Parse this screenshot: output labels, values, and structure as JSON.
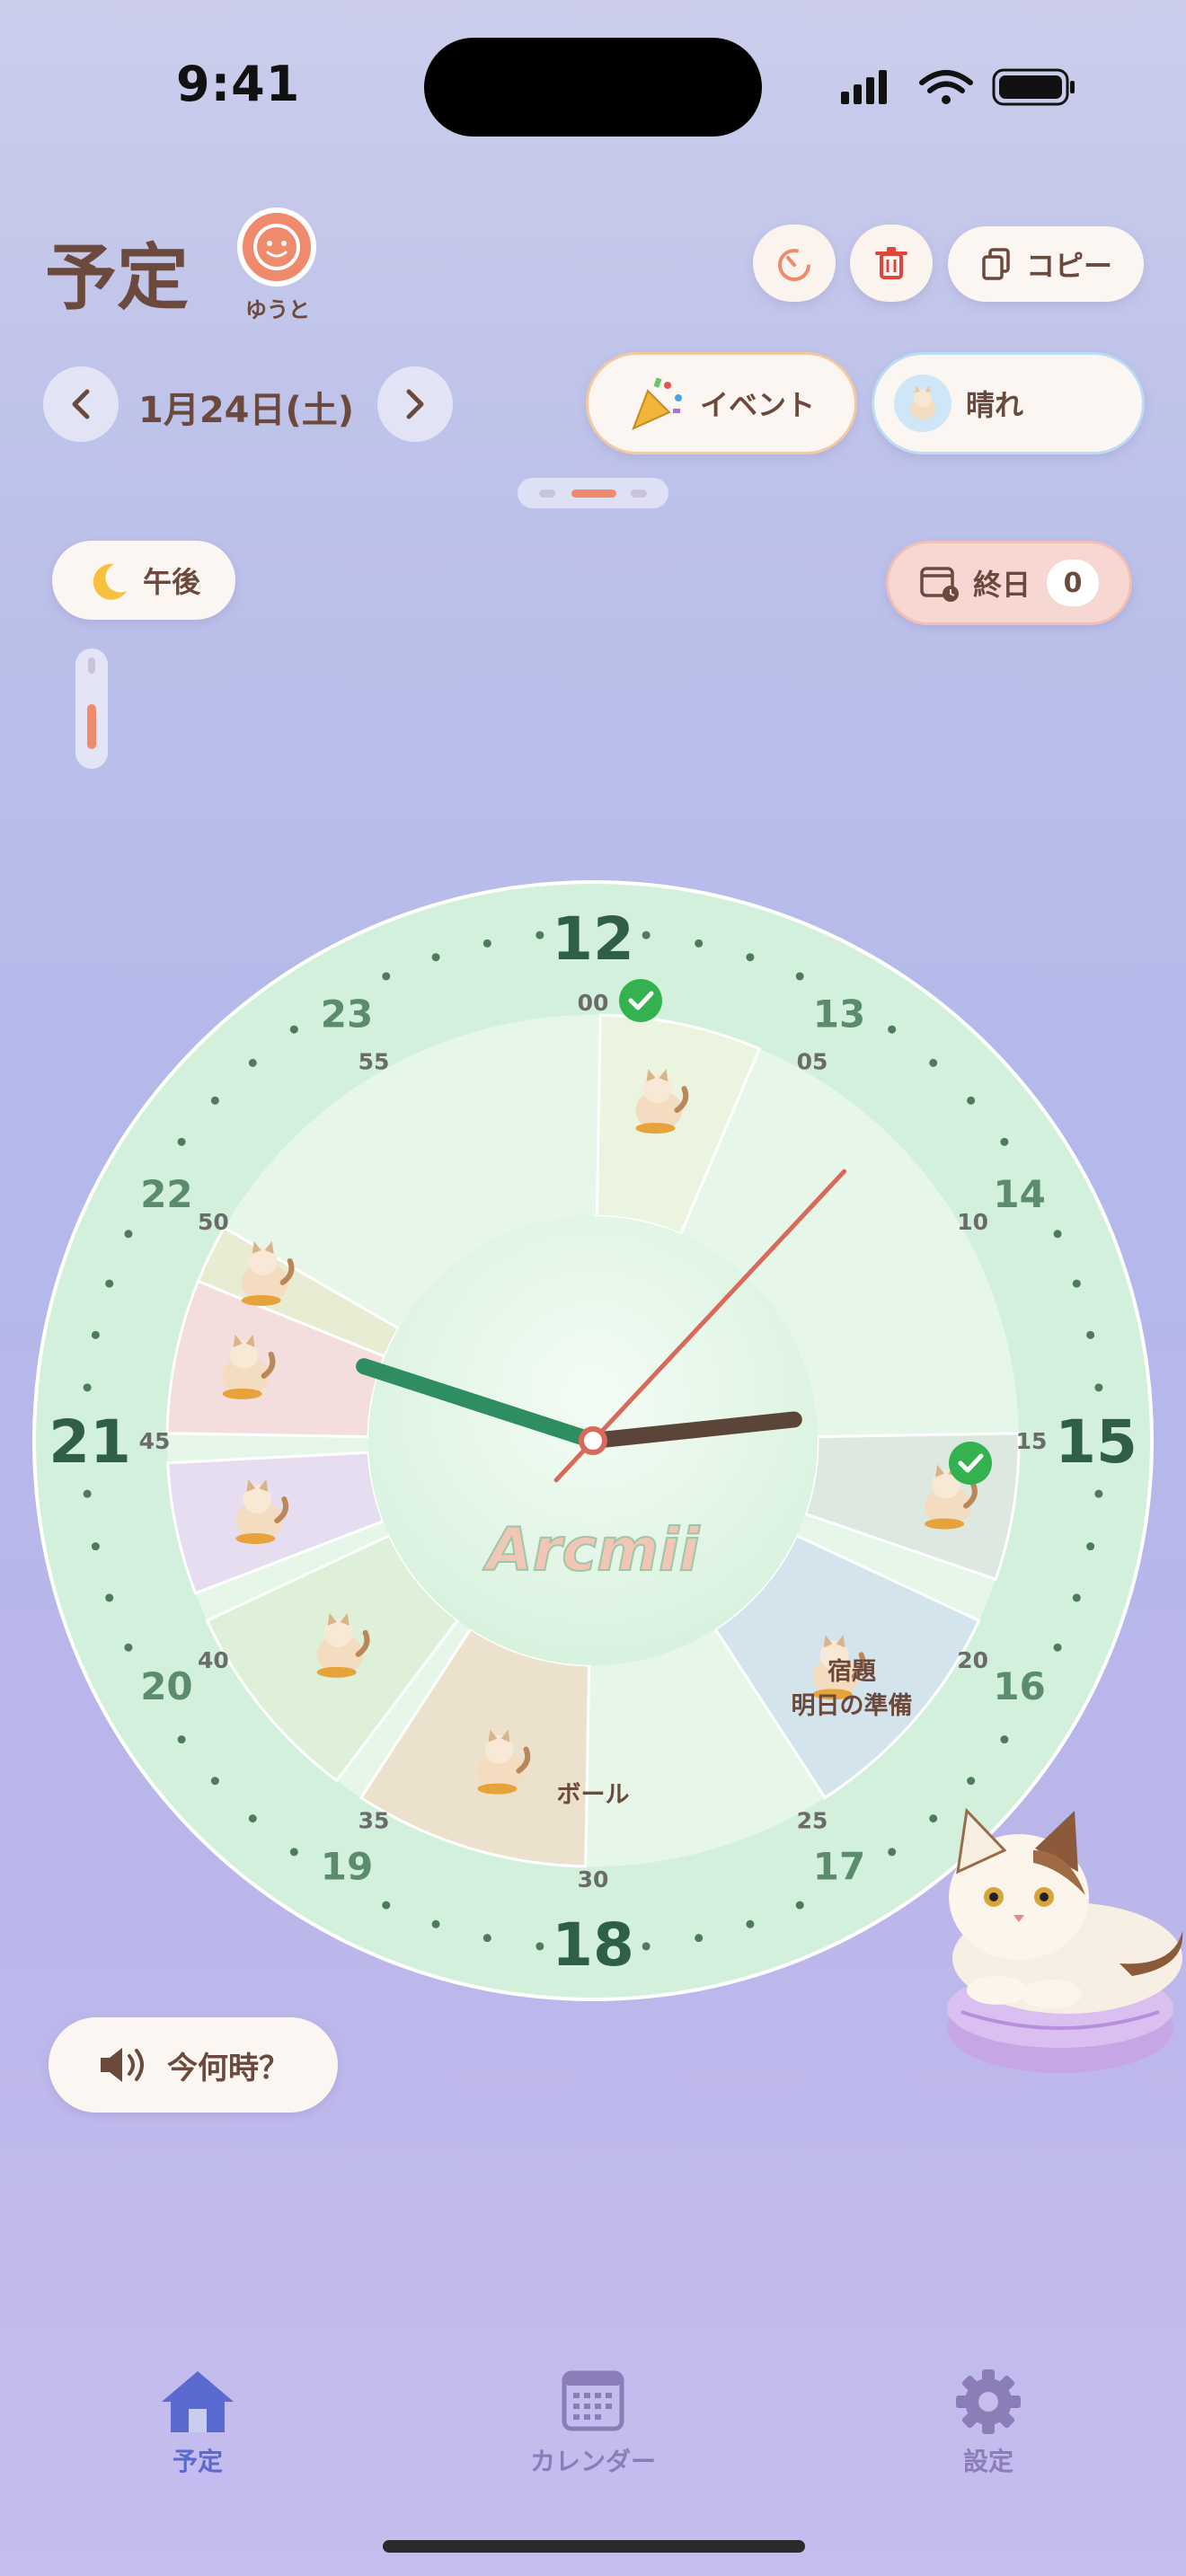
{
  "status_bar": {
    "time": "9:41"
  },
  "header": {
    "title": "予定",
    "avatar_name": "ゆうと",
    "copy_label": "コピー"
  },
  "date_nav": {
    "date": "1月24日(土)"
  },
  "chips": {
    "event_label": "イベント",
    "weather_label": "晴れ"
  },
  "period": {
    "label": "午後"
  },
  "all_day": {
    "label": "終日",
    "count": "0"
  },
  "clock": {
    "brand": "Arcmii",
    "hour_labels": [
      "12",
      "13",
      "14",
      "15",
      "16",
      "17",
      "18",
      "19",
      "20",
      "21",
      "22",
      "23"
    ],
    "minute_labels": [
      "00",
      "05",
      "10",
      "15",
      "20",
      "25",
      "30",
      "35",
      "40",
      "45",
      "50",
      "55"
    ],
    "time_shown": "14:48",
    "events": [
      {
        "label": "宿題\n明日の準備"
      },
      {
        "label": "ボール"
      }
    ]
  },
  "voice_button": {
    "label": "今何時？"
  },
  "tab_bar": {
    "items": [
      {
        "label": "予定",
        "icon": "home-icon"
      },
      {
        "label": "カレンダー",
        "icon": "calendar-icon"
      },
      {
        "label": "設定",
        "icon": "gear-icon"
      }
    ]
  },
  "colors": {
    "accent": "#ef8a6c",
    "brown": "#6b4a3d",
    "clock_face": "#d6f1df",
    "nav_active": "#5a6ad0",
    "nav_inactive": "#8a7db8"
  }
}
